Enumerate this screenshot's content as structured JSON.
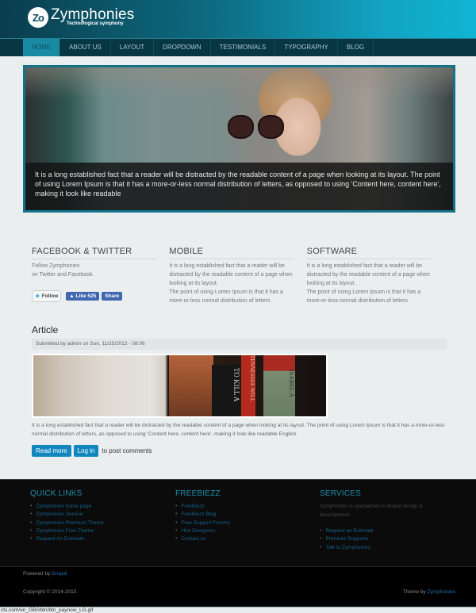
{
  "header": {
    "logo_mark": "Zo",
    "site_name": "Zymphonies",
    "tagline": "Technological symphony"
  },
  "nav": {
    "items": [
      {
        "label": "HOME",
        "active": true
      },
      {
        "label": "ABOUT US"
      },
      {
        "label": "LAYOUT"
      },
      {
        "label": "DROPDOWN"
      },
      {
        "label": "TESTIMONIALS"
      },
      {
        "label": "TYPOGRAPHY"
      },
      {
        "label": "BLOG"
      }
    ]
  },
  "banner": {
    "caption": "It is a long established fact that a reader will be distracted by the readable content of a page when looking at its layout. The point of using Lorem Ipsum is that it has a more-or-less normal distribution of letters, as opposed to using 'Content here, content here', making it look like readable"
  },
  "columns": [
    {
      "title": "FACEBOOK & TWITTER",
      "text_lines": [
        "Follow Zymphonies",
        "on Twitter and Facebook."
      ],
      "twitter_follow": "Follow",
      "fb_like": "Like 525",
      "fb_share": "Share"
    },
    {
      "title": "MOBILE",
      "text1": "It is a long established fact that a reader will be distracted by the readable content of a page when looking at its layout.",
      "text2": "The point of using Lorem Ipsum is that it has a more-or-less normal distribution of letters"
    },
    {
      "title": "SOFTWARE",
      "text1": "It is a long established fact that a reader will be distracted by the readable content of a page when looking at its layout.",
      "text2": "The point of using Lorem Ipsum is that it has a more-or-less normal distribution of letters"
    }
  ],
  "article": {
    "title": "Article",
    "submitted": "Submitted by admin on Sun, 11/25/2012 - 08:06",
    "image_books": [
      "TO KILL A",
      "TENNESSEE WILL",
      "ISABEL A"
    ],
    "body": "It is a long established fact that a reader will be distracted by the readable content of a page when looking at its layout. The point of using Lorem Ipsum is that it has a more-or-less normal distribution of letters, as opposed to using 'Content here, content here', making it look like readable English.",
    "read_more": "Read more",
    "login": "Log in",
    "post_comments": "to post comments"
  },
  "footer": {
    "quick_links": {
      "title": "QUICK LINKS",
      "items": [
        "Zymphonies home page",
        "Zymphonies Service",
        "Zymphonies Premium Theme",
        "Zymphonies Free Theme",
        "Request An Estimate"
      ]
    },
    "freebiezz": {
      "title": "FREEBIEZZ",
      "items": [
        "FreeBiezz",
        "FreeBiezz Blog",
        "Free Support Forums",
        "Hire Designers",
        "Contact us"
      ]
    },
    "services": {
      "title": "SERVICES",
      "description": "Zymphonies is specialized in drupal design & development.",
      "items": [
        "Request an Estimate",
        "Premium Supports",
        "Talk to Zymphonies"
      ]
    },
    "powered_by": "Powered by",
    "powered_link": "Drupal",
    "copyright": "Copyright © 2014-2015.",
    "theme_by": "Theme by",
    "theme_link": "Zymphonies"
  },
  "status_bar": {
    "url": "cts.com/en_GB/i/btn/btn_paynow_LG.gif"
  }
}
